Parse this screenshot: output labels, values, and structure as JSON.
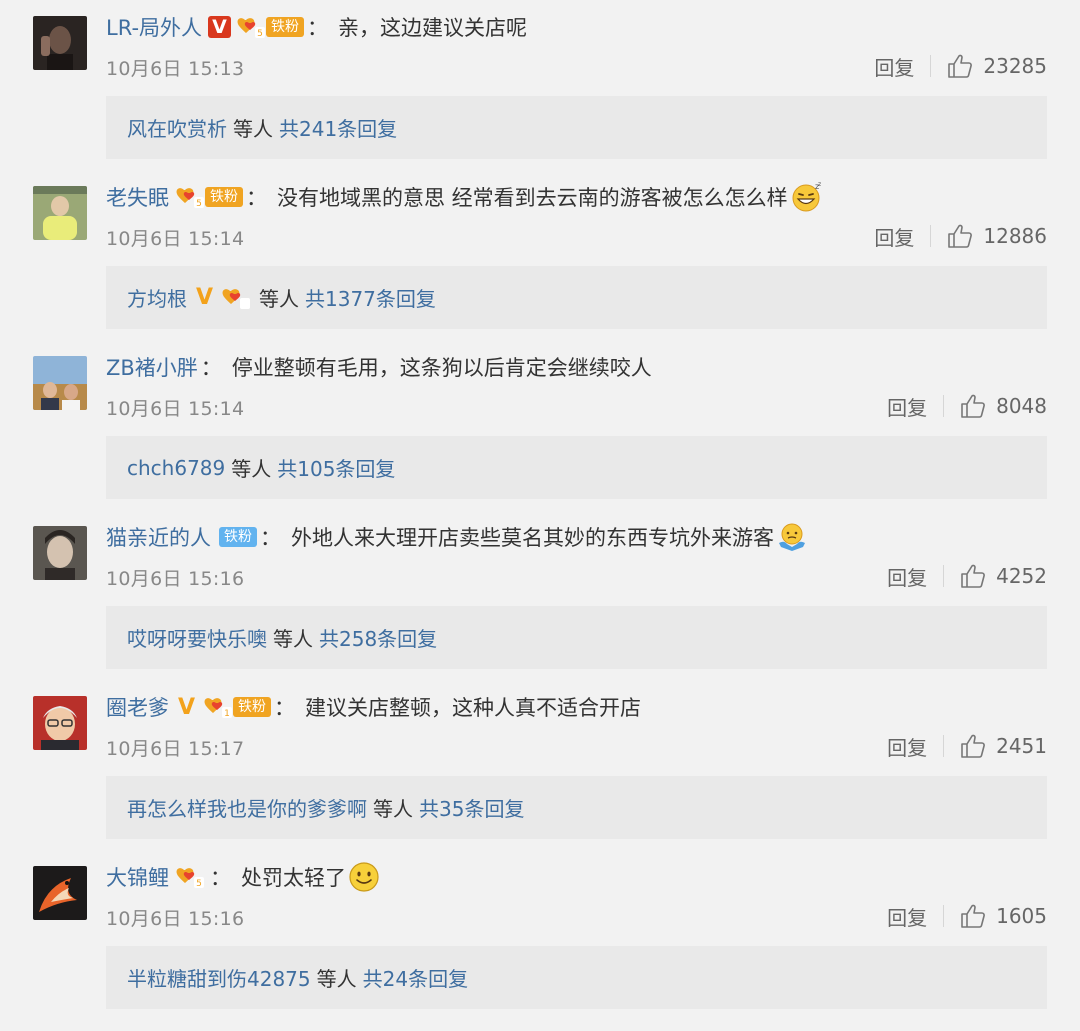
{
  "comments": [
    {
      "username": "LR-局外人",
      "text": "亲，这边建议关店呢",
      "time": "10月6日 15:13",
      "reply_label": "回复",
      "likes": "23285",
      "reply_preview": {
        "name": "风在吹赏析",
        "etc": "等人",
        "total": "共241条回复"
      }
    },
    {
      "username": "老失眠",
      "text": "没有地域黑的意思 经常看到去云南的游客被怎么怎么样",
      "time": "10月6日 15:14",
      "reply_label": "回复",
      "likes": "12886",
      "reply_preview": {
        "name": "方均根",
        "etc": "等人",
        "total": "共1377条回复"
      }
    },
    {
      "username": "ZB褚小胖",
      "text": "停业整顿有毛用，这条狗以后肯定会继续咬人",
      "time": "10月6日 15:14",
      "reply_label": "回复",
      "likes": "8048",
      "reply_preview": {
        "name": "chch6789",
        "etc": "等人",
        "total": "共105条回复"
      }
    },
    {
      "username": "猫亲近的人",
      "text": "外地人来大理开店卖些莫名其妙的东西专坑外来游客",
      "time": "10月6日 15:16",
      "reply_label": "回复",
      "likes": "4252",
      "reply_preview": {
        "name": "哎呀呀要快乐噢",
        "etc": "等人",
        "total": "共258条回复"
      }
    },
    {
      "username": "圈老爹",
      "text": "建议关店整顿，这种人真不适合开店",
      "time": "10月6日 15:17",
      "reply_label": "回复",
      "likes": "2451",
      "reply_preview": {
        "name": "再怎么样我也是你的爹爹啊",
        "etc": "等人",
        "total": "共35条回复"
      }
    },
    {
      "username": "大锦鲤",
      "text": "处罚太轻了",
      "time": "10月6日 15:16",
      "reply_label": "回复",
      "likes": "1605",
      "reply_preview": {
        "name": "半粒糖甜到伤42875",
        "etc": "等人",
        "total": "共24条回复"
      }
    }
  ],
  "badges": {
    "tiefen_label": "铁粉",
    "colon": "：",
    "v_mark": "V"
  },
  "colors": {
    "background": "#f2f2f2",
    "link": "#3f6ea0",
    "reply_box": "#e9e9e9",
    "verified_red": "#d9381e",
    "verified_gold": "#f3a21b",
    "tiefen_orange": "#f0a422",
    "tiefen_blue": "#62b3ef"
  },
  "icons": {
    "like": "thumbs-up-icon",
    "fan_heart": "heart-level-icon",
    "emoji_2": "grin-emoji-icon",
    "emoji_4": "shrug-emoji-icon",
    "emoji_6": "smile-emoji-icon"
  }
}
